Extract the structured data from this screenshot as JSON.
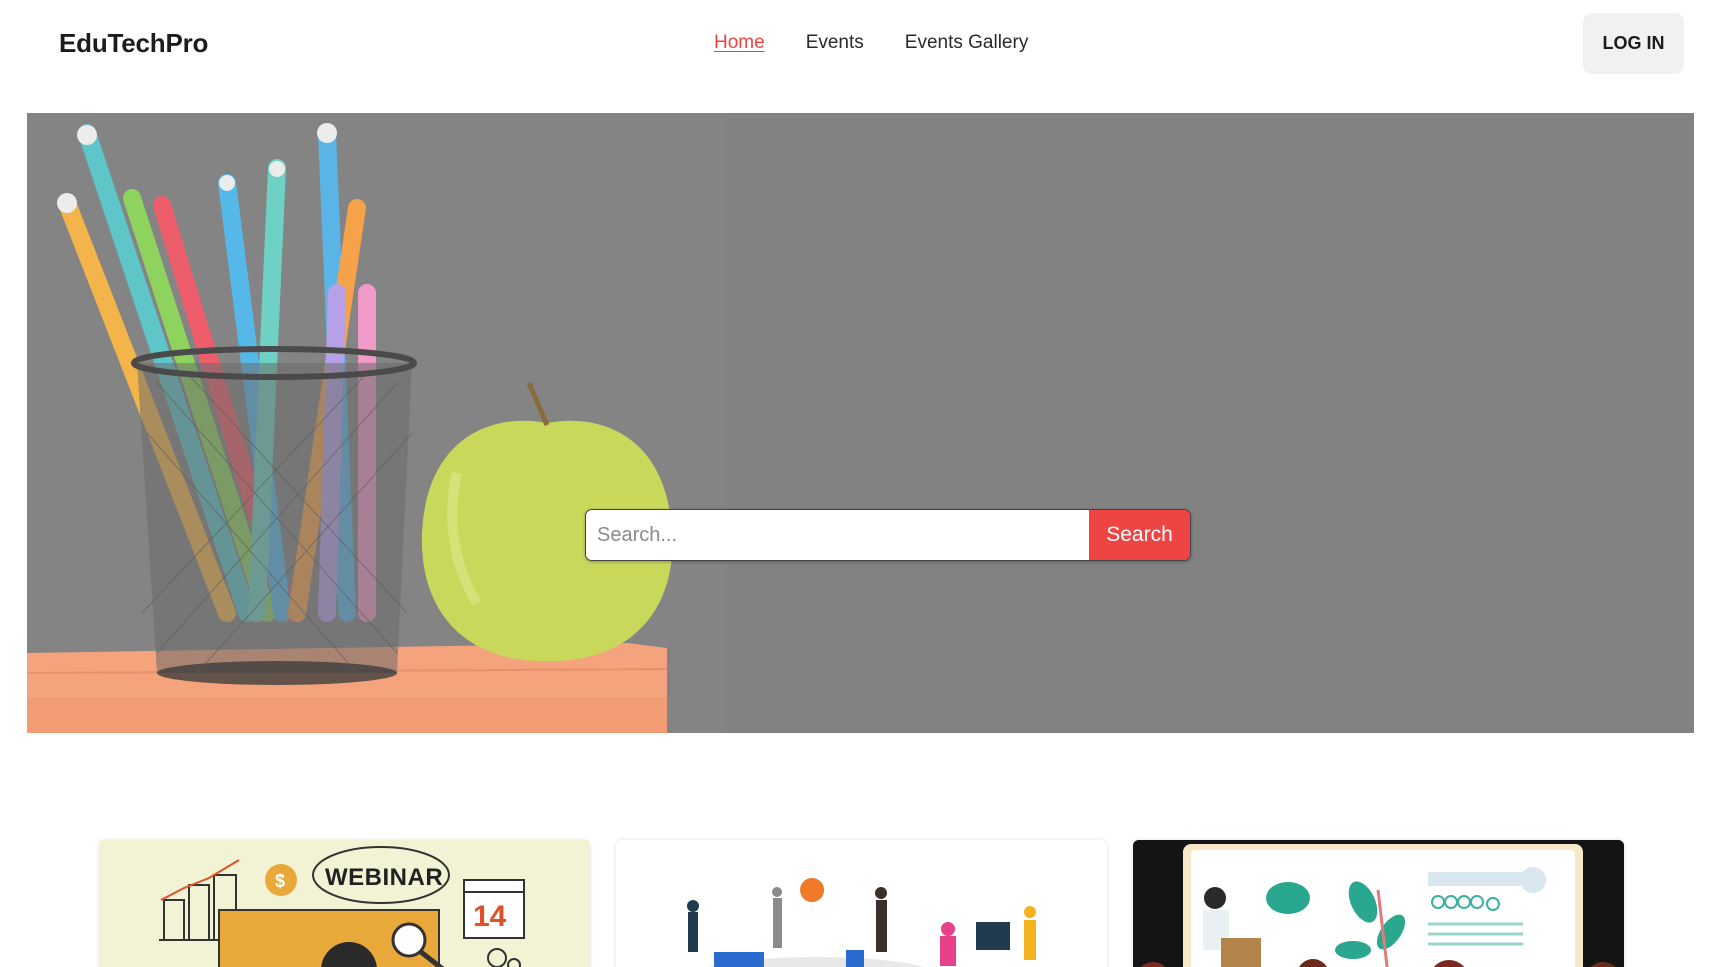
{
  "header": {
    "brand": "EduTechPro",
    "nav": [
      {
        "label": "Home",
        "active": true
      },
      {
        "label": "Events",
        "active": false
      },
      {
        "label": "Events Gallery",
        "active": false
      }
    ],
    "login_label": "LOG IN"
  },
  "hero": {
    "search_placeholder": "Search...",
    "search_button": "Search"
  },
  "cards": [
    {
      "name": "webinar-card",
      "banner_text": "WEBINAR",
      "date_text": "14"
    },
    {
      "name": "event-people-card"
    },
    {
      "name": "presentation-card"
    }
  ],
  "colors": {
    "accent": "#ef4444",
    "login_bg": "#f1f1f1",
    "hero_bg": "#858585"
  }
}
